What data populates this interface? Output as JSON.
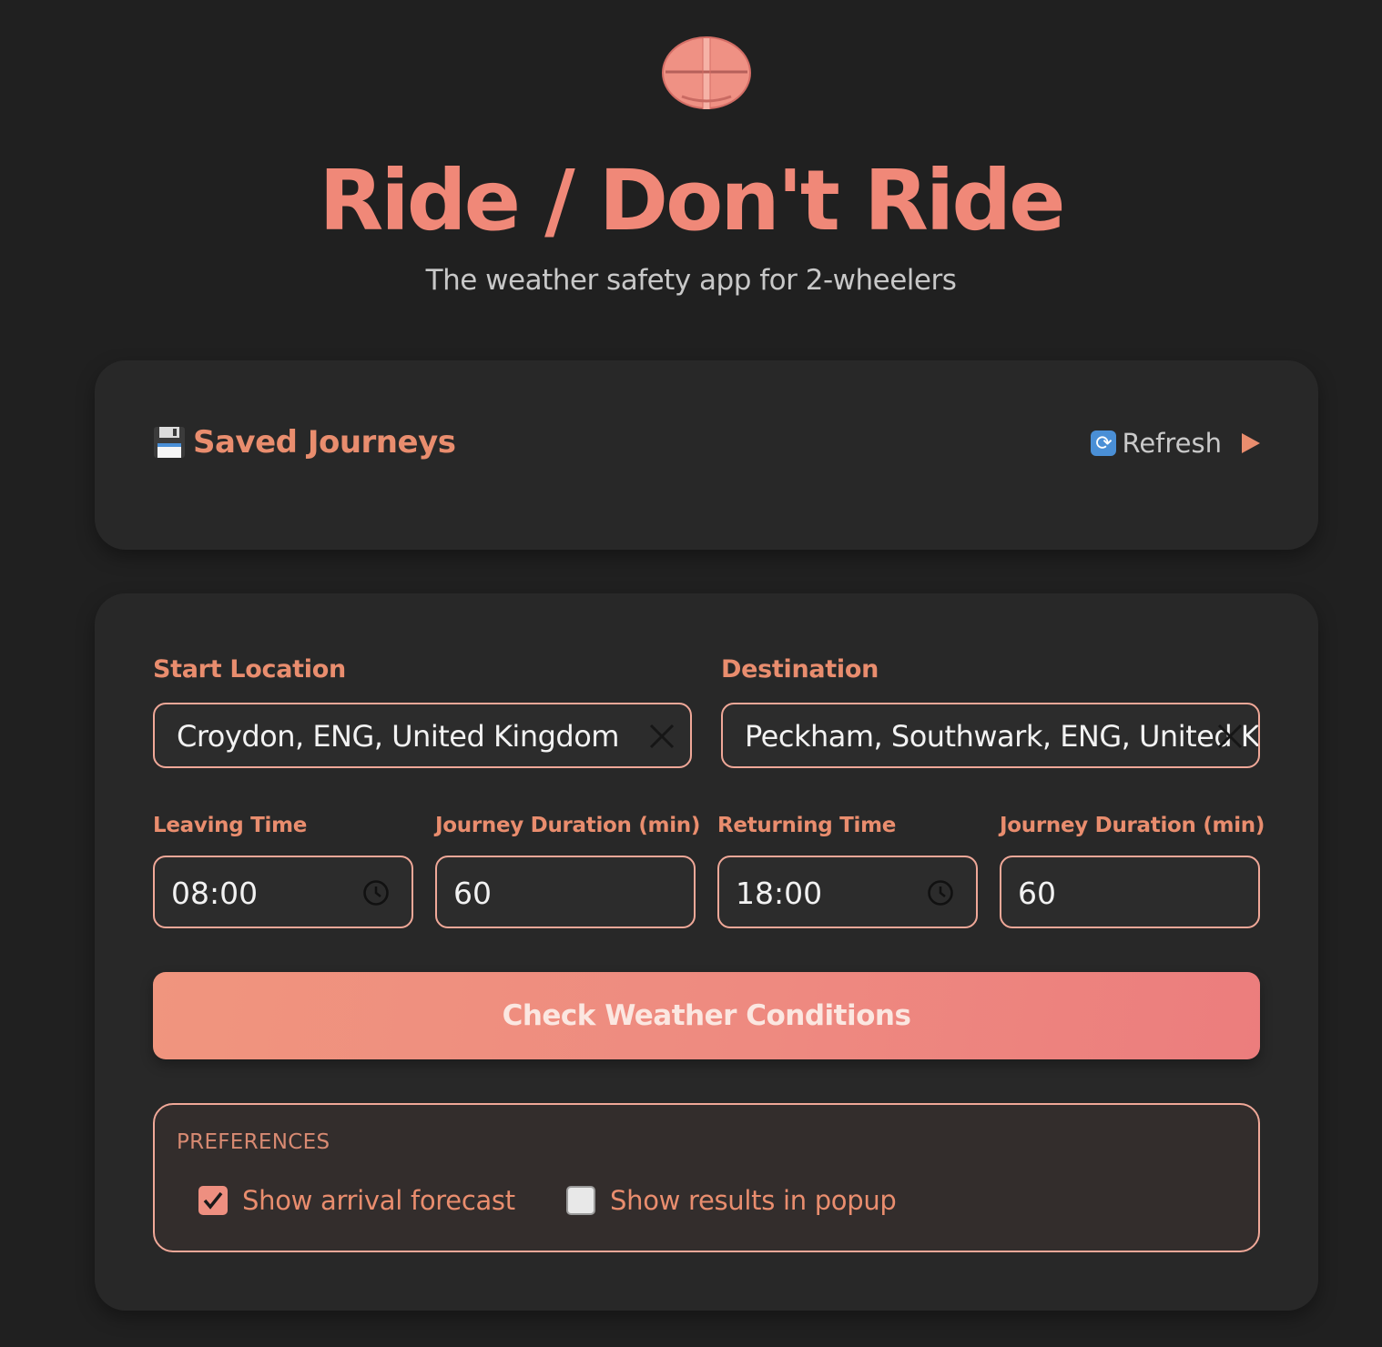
{
  "app": {
    "title": "Ride / Don't Ride",
    "subtitle": "The weather safety app for 2-wheelers",
    "logo_icon": "helmet-icon"
  },
  "saved_journeys": {
    "icon": "floppy-disk-icon",
    "title": "Saved Journeys",
    "refresh_icon": "refresh-icon",
    "refresh_label": "Refresh",
    "expand_icon": "play-icon"
  },
  "form": {
    "start_location": {
      "label": "Start Location",
      "value": "Croydon, ENG, United Kingdom"
    },
    "destination": {
      "label": "Destination",
      "value": "Peckham, Southwark, ENG, United Kingdom"
    },
    "leaving_time": {
      "label": "Leaving Time",
      "value": "08:00"
    },
    "leaving_duration": {
      "label": "Journey Duration (min)",
      "value": "60"
    },
    "returning_time": {
      "label": "Returning Time",
      "value": "18:00"
    },
    "returning_duration": {
      "label": "Journey Duration (min)",
      "value": "60"
    },
    "submit_label": "Check Weather Conditions"
  },
  "preferences": {
    "title": "PREFERENCES",
    "items": [
      {
        "label": "Show arrival forecast",
        "checked": true
      },
      {
        "label": "Show results in popup",
        "checked": false
      }
    ]
  },
  "colors": {
    "background": "#202020",
    "card": "#282828",
    "accent": "#f08878",
    "label": "#e98d6e",
    "input_border": "#f0a898"
  }
}
